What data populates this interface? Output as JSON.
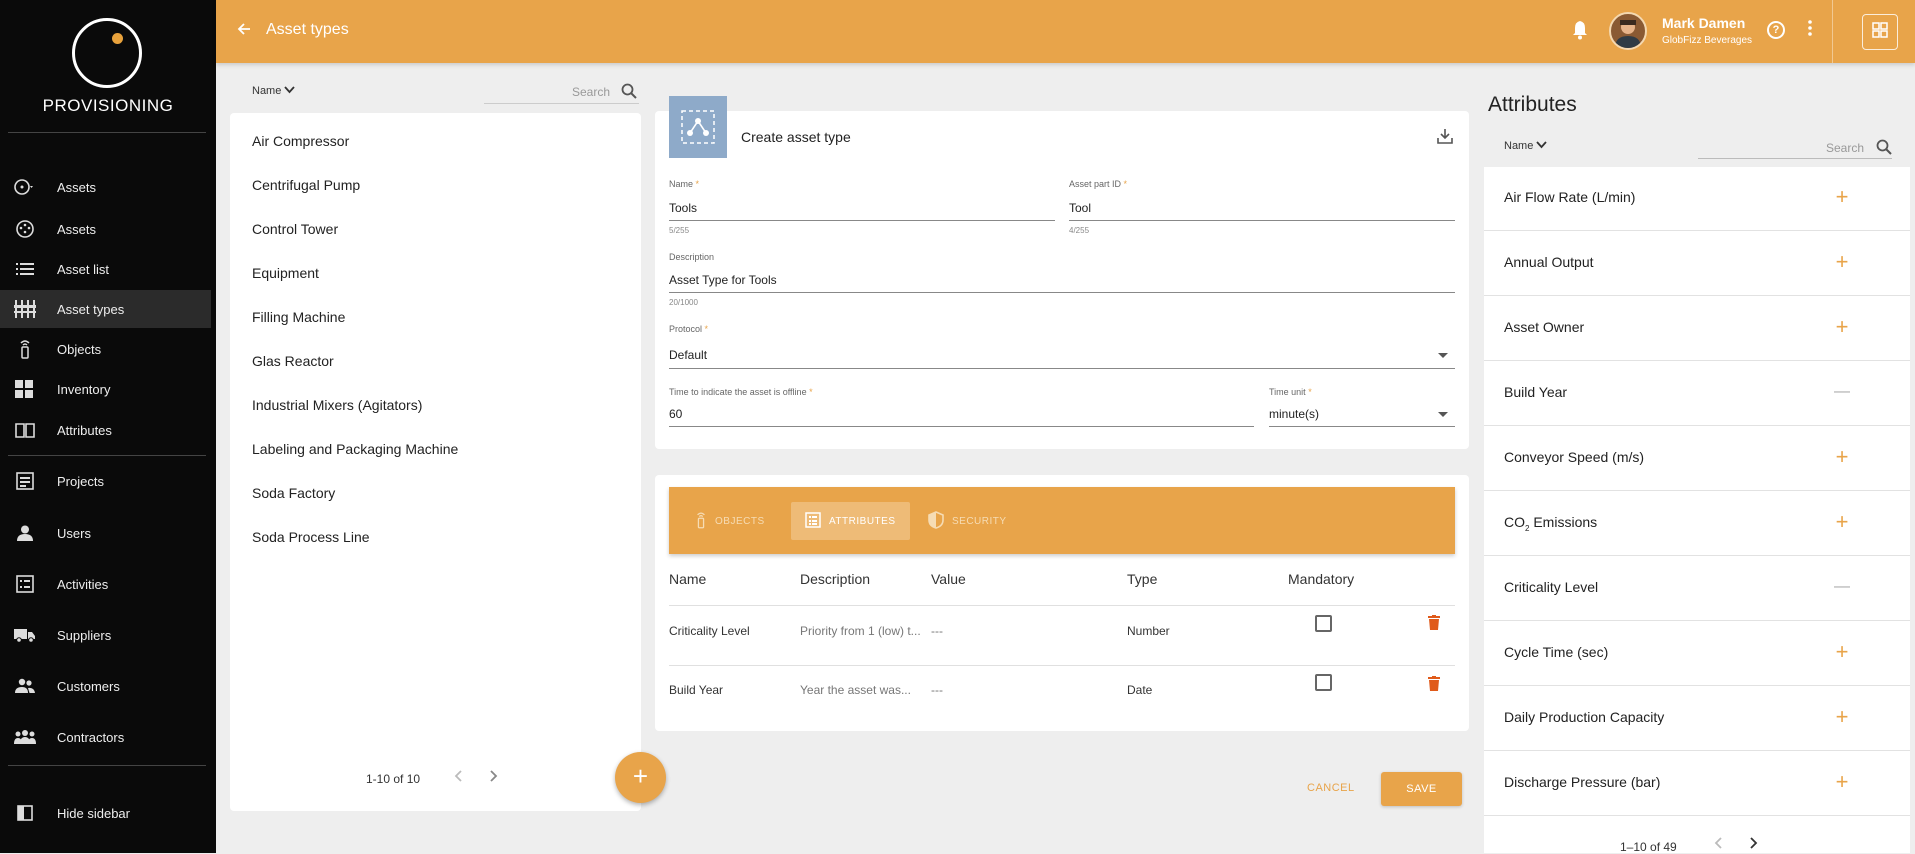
{
  "sidebar": {
    "logo_text": "PROVISIONING",
    "items": [
      {
        "label": "Assets",
        "icon": "dashboard-dropdown-icon"
      },
      {
        "label": "Assets",
        "icon": "assets-icon"
      },
      {
        "label": "Asset list",
        "icon": "list-icon"
      },
      {
        "label": "Asset types",
        "icon": "asset-types-icon"
      },
      {
        "label": "Objects",
        "icon": "sensor-icon"
      },
      {
        "label": "Inventory",
        "icon": "inventory-icon"
      },
      {
        "label": "Attributes",
        "icon": "book-icon"
      },
      {
        "label": "Projects",
        "icon": "projects-icon"
      },
      {
        "label": "Users",
        "icon": "user-icon"
      },
      {
        "label": "Activities",
        "icon": "activities-icon"
      },
      {
        "label": "Suppliers",
        "icon": "truck-icon"
      },
      {
        "label": "Customers",
        "icon": "customers-icon"
      },
      {
        "label": "Contractors",
        "icon": "contractors-icon"
      }
    ],
    "hide_label": "Hide sidebar"
  },
  "header": {
    "title": "Asset types",
    "user_name": "Mark Damen",
    "user_org": "GlobFizz Beverages",
    "accent": "#e8a44a"
  },
  "list": {
    "sort_label": "Name",
    "search_placeholder": "Search",
    "items": [
      "Air Compressor",
      "Centrifugal Pump",
      "Control Tower",
      "Equipment",
      "Filling Machine",
      "Glas Reactor",
      "Industrial Mixers (Agitators)",
      "Labeling and Packaging Machine",
      "Soda Factory",
      "Soda Process Line"
    ],
    "pager": "1-10 of 10",
    "fab": "+"
  },
  "form": {
    "title": "Create asset type",
    "name_label": "Name",
    "name_value": "Tools",
    "name_count": "5/255",
    "part_label": "Asset part ID",
    "part_value": "Tool",
    "part_count": "4/255",
    "desc_label": "Description",
    "desc_value": "Asset Type for Tools",
    "desc_count": "20/1000",
    "protocol_label": "Protocol",
    "protocol_value": "Default",
    "offline_label": "Time to indicate the asset is offline",
    "offline_value": "60",
    "unit_label": "Time unit",
    "unit_value": "minute(s)",
    "required_mark": "*"
  },
  "tabs": [
    {
      "label": "OBJECTS",
      "active": false
    },
    {
      "label": "ATTRIBUTES",
      "active": true
    },
    {
      "label": "SECURITY",
      "active": false
    }
  ],
  "table": {
    "headers": [
      "Name",
      "Description",
      "Value",
      "Type",
      "Mandatory"
    ],
    "rows": [
      {
        "name": "Criticality Level",
        "description": "Priority from 1 (low) t...",
        "value": "---",
        "type": "Number"
      },
      {
        "name": "Build Year",
        "description": "Year the asset was...",
        "value": "---",
        "type": "Date"
      }
    ]
  },
  "actions": {
    "cancel": "CANCEL",
    "save": "SAVE"
  },
  "attributes": {
    "title": "Attributes",
    "sort_label": "Name",
    "search_placeholder": "Search",
    "items": [
      {
        "label": "Air Flow Rate (L/min)",
        "action": "+"
      },
      {
        "label": "Annual Output",
        "action": "+"
      },
      {
        "label": "Asset Owner",
        "action": "+"
      },
      {
        "label": "Build Year",
        "action": "—"
      },
      {
        "label": "Conveyor Speed (m/s)",
        "action": "+"
      },
      {
        "label": "CO2 Emissions",
        "action": "+"
      },
      {
        "label": "Criticality Level",
        "action": "—"
      },
      {
        "label": "Cycle Time (sec)",
        "action": "+"
      },
      {
        "label": "Daily Production Capacity",
        "action": "+"
      },
      {
        "label": "Discharge Pressure (bar)",
        "action": "+"
      }
    ],
    "co2_prefix": "CO",
    "co2_sub": "2",
    "co2_suffix": " Emissions",
    "pager": "1–10 of 49"
  }
}
